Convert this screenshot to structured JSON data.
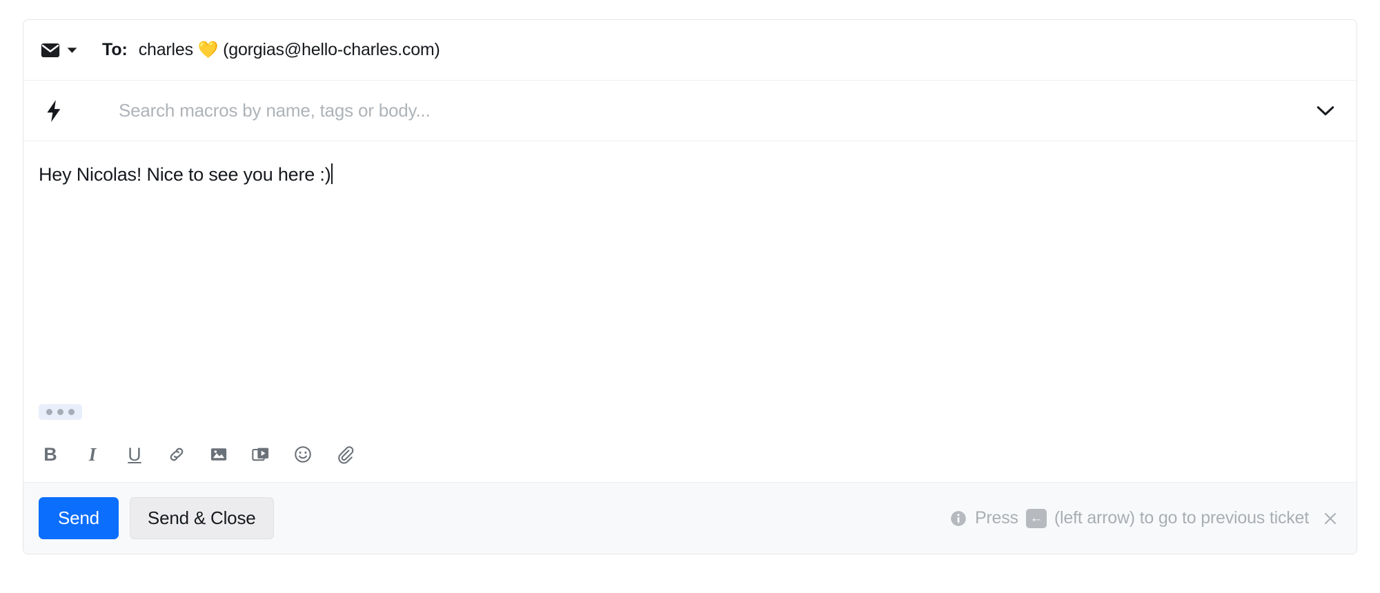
{
  "composer": {
    "recipient": {
      "channel_icon": "envelope-icon",
      "channel_caret_icon": "caret-down-icon",
      "to_label": "To:",
      "contact_name": "charles",
      "contact_emoji": "💛",
      "contact_email": "(gorgias@hello-charles.com)"
    },
    "macros": {
      "bolt_icon": "lightning-bolt-icon",
      "placeholder": "Search macros by name, tags or body...",
      "value": "",
      "expand_icon": "chevron-down-icon"
    },
    "body": {
      "text": "Hey Nicolas! Nice to see you here :)",
      "typing_indicator": "typing-indicator-dots"
    },
    "format_toolbar": [
      {
        "name": "bold-button",
        "glyph": "B"
      },
      {
        "name": "italic-button",
        "glyph": "I"
      },
      {
        "name": "underline-button",
        "glyph": "U"
      },
      {
        "name": "link-button",
        "glyph": "link-icon"
      },
      {
        "name": "image-button",
        "glyph": "image-icon"
      },
      {
        "name": "video-button",
        "glyph": "video-icon"
      },
      {
        "name": "emoji-button",
        "glyph": "smiley-icon"
      },
      {
        "name": "attachment-button",
        "glyph": "paperclip-icon"
      }
    ],
    "footer": {
      "send_label": "Send",
      "send_close_label": "Send & Close",
      "hint_prefix": "Press",
      "hint_key": "←",
      "hint_suffix": "(left arrow) to go to previous ticket",
      "close_hint_icon": "close-icon",
      "info_icon": "info-icon"
    }
  },
  "colors": {
    "accent_blue": "#0b6efd",
    "secondary_button": "#ececee",
    "footer_bg": "#f8f9fa",
    "border": "#e4e6e8",
    "muted_text": "#a9aeb4",
    "typing_bg": "#e9effa"
  }
}
